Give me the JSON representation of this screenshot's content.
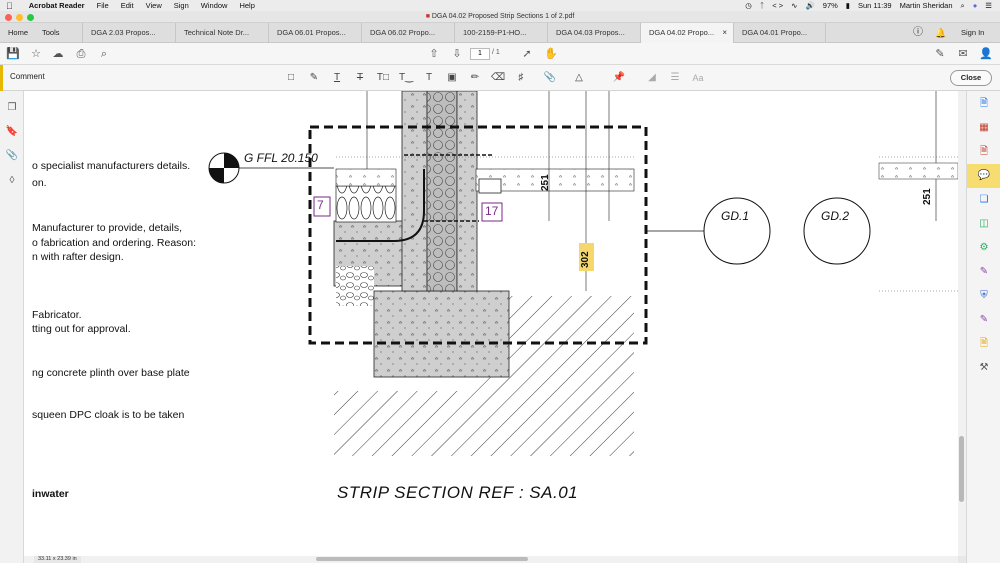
{
  "menubar": {
    "apple": "",
    "app": "Acrobat Reader",
    "items": [
      "File",
      "Edit",
      "View",
      "Sign",
      "Window",
      "Help"
    ],
    "battery": "97%",
    "clock": "Sun 11:39",
    "user": "Martin Sheridan"
  },
  "window": {
    "title": "DGA 04.02 Proposed Strip Sections 1 of 2.pdf"
  },
  "tabs": {
    "home": "Home",
    "tools": "Tools",
    "items": [
      "DGA 2.03 Propos...",
      "Technical Note Dr...",
      "DGA 06.01 Propos...",
      "DGA 06.02 Propo...",
      "100-2159-P1-HO...",
      "DGA 04.03 Propos...",
      "DGA 04.02 Propo...",
      "DGA 04.01 Propo..."
    ],
    "active_index": 6,
    "signin": "Sign In"
  },
  "page_nav": {
    "current": "1",
    "total": "/ 1"
  },
  "comment_toolbar": {
    "label": "Comment",
    "close": "Close"
  },
  "document": {
    "left_text": [
      "o specialist manufacturers details.",
      "on.",
      "Manufacturer to provide, details,",
      "o fabrication and ordering. Reason:",
      "n with rafter design.",
      "Fabricator.",
      "tting out for approval.",
      "ng concrete plinth over base plate",
      "squeen DPC cloak is to be taken",
      "inwater"
    ],
    "level_label": "G FFL 20.150",
    "tag_7": "7",
    "tag_17": "17",
    "dim_251": "251",
    "dim_302": "302",
    "dim_251b": "251",
    "gd1": "GD.1",
    "gd2": "GD.2",
    "section_title": "STRIP SECTION REF : SA.01"
  },
  "status": {
    "page_size": "33.11 x 23.39 in"
  },
  "colors": {
    "comment_accent": "#e6b800",
    "tag_purple": "#7a2a8a",
    "dim_highlight": "#f5d76e"
  }
}
